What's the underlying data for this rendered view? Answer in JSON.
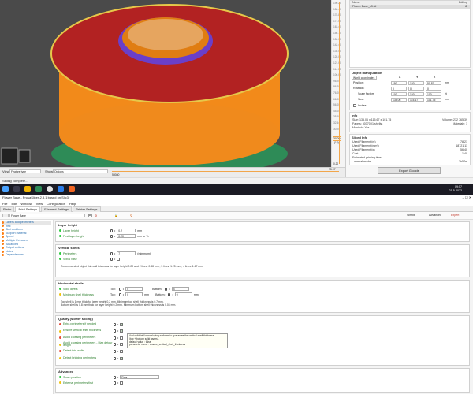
{
  "top": {
    "view_bar": {
      "view_label": "View",
      "view_value": "Feature type",
      "show_label": "Show",
      "show_value": "Options",
      "left_number": "58080",
      "right_number": "95.97"
    },
    "layer_slider": {
      "top_values": [
        "190.20",
        "186.40",
        "178.80",
        "171.00",
        "163.40",
        "156.70",
        "150.00",
        "142.40",
        "135.00",
        "128.00",
        "121.00",
        "114.00",
        "106.00",
        "96.20",
        "86.20",
        "76.00",
        "66.00",
        "56.00",
        "45.00",
        "35.60",
        "32.44",
        "30.20"
      ],
      "highlight": "30.20",
      "sub_highlight": "(14)",
      "bottom": "0.20",
      "bottom_sub": "(1)"
    },
    "objects": {
      "name_col": "Name",
      "editing_col": "Editing",
      "item": "Flower Base_v3.stl"
    },
    "manipulation": {
      "title": "Object manipulation",
      "coord_select": "World coordinates",
      "axes": [
        "X",
        "Y",
        "Z"
      ],
      "position_label": "Position:",
      "position": [
        "190",
        "100",
        "50.87"
      ],
      "position_unit": "mm",
      "rotation_label": "Rotation:",
      "rotation": [
        "0",
        "0",
        "0"
      ],
      "rotation_unit": "°",
      "scale_label": "Scale factors",
      "scale": [
        "100",
        "100",
        "100"
      ],
      "scale_unit": "%",
      "size_label": "Size:",
      "size": [
        "135.06",
        "115.67",
        "101.75"
      ],
      "size_unit": "mm",
      "inches_label": "Inches"
    },
    "info": {
      "title": "Info",
      "size_label": "Size:",
      "size_value": "135.06 x 115.67 x 101.75",
      "volume_label": "Volume:",
      "volume_value": "232 765.39",
      "facets_label": "Facets:",
      "facets_value": "50370 (1 shells)",
      "materials_label": "Materials:",
      "materials_value": "1",
      "manifold_label": "Manifold:",
      "manifold_value": "Yes"
    },
    "sliced": {
      "title": "Sliced Info",
      "rows": [
        {
          "k": "Used Filament (m)",
          "v": "78.21"
        },
        {
          "k": "Used Filament (mm³)",
          "v": "18721.11"
        },
        {
          "k": "Used Filament (g)",
          "v": "56.40"
        },
        {
          "k": "Cost",
          "v": "1.40"
        },
        {
          "k": "Estimated printing time:",
          "v": ""
        },
        {
          "k": "- normal mode",
          "v": "3h57m"
        }
      ]
    },
    "export_button": "Export G-code",
    "status": "Slicing complete..."
  },
  "taskbar": {
    "search_placeholder": "",
    "time": "09:57",
    "date": "21-5-2022"
  },
  "app2": {
    "title": "Flower Base - PrusaSlicer-2.3.1 based on Slic3r",
    "menu": [
      "File",
      "Edit",
      "Window",
      "View",
      "Configuration",
      "Help"
    ],
    "tabs": [
      "Plater",
      "Print Settings",
      "Filament Settings",
      "Printer Settings"
    ],
    "preset": "Flower Base",
    "mode_buttons": [
      "Simple",
      "Advanced",
      "Expert"
    ],
    "tree": [
      {
        "label": "Layers and perimeters",
        "color": "#fd7e14",
        "sel": true
      },
      {
        "label": "Infill",
        "color": "#fd7e14"
      },
      {
        "label": "Skirt and brim",
        "color": "#fd7e14"
      },
      {
        "label": "Support material",
        "color": "#fd7e14"
      },
      {
        "label": "Speed",
        "color": "#fd7e14"
      },
      {
        "label": "Multiple Extruders",
        "color": "#fd7e14"
      },
      {
        "label": "Advanced",
        "color": "#fd7e14"
      },
      {
        "label": "Output options",
        "color": "#fd7e14"
      },
      {
        "label": "Notes",
        "color": "#fd7e14"
      },
      {
        "label": "Dependencies",
        "color": "#fd7e14"
      }
    ],
    "layer_height": {
      "title": "Layer height",
      "rows": [
        {
          "label": "Layer height",
          "value": "0.2",
          "unit": "mm"
        },
        {
          "label": "First layer height",
          "value": "0.20",
          "unit": "mm or %"
        }
      ]
    },
    "vertical_shells": {
      "title": "Vertical shells",
      "perimeters_label": "Perimeters",
      "perimeters_value": "7",
      "perimeters_unit": "(minimum)",
      "spiral_label": "Spiral vase",
      "note": "Recommended object thin wall thickness for layer height 0.20 and 2 lines: 0.88 mm , 3 lines: 1.25 mm , 4 lines: 1.67 mm"
    },
    "horizontal_shells": {
      "title": "Horizontal shells",
      "solid_label": "Solid layers",
      "min_thick_label": "Minimum shell thickness",
      "top_label": "Top:",
      "bottom_label": "Bottom:",
      "solid_top": "5",
      "solid_bottom": "4",
      "min_top": "0",
      "min_bottom": "0",
      "unit": "mm",
      "note": "Top shell is 1 mm thick for layer height 0.2 mm. Minimum top shell thickness is 0.7 mm.\nBottom shell is 0.8 mm thick for layer height 0.2 mm. Minimum bottom shell thickness is 0.04 mm."
    },
    "quality": {
      "title": "Quality (slower slicing)",
      "rows": [
        {
          "label": "Extra perimeters if needed",
          "checked": true
        },
        {
          "label": "Ensure vertical shell thickness",
          "checked": true
        },
        {
          "label": "Avoid crossing perimeters",
          "checked": false
        },
        {
          "label": "Avoid crossing perimeters - Max detour length",
          "checked": false
        },
        {
          "label": "Detect thin walls",
          "checked": false
        },
        {
          "label": "Detect bridging perimeters",
          "checked": true
        }
      ],
      "tooltip_lines": [
        "Add solid infill near sloping surfaces to guarantee the vertical shell thickness",
        "(top + bottom solid layers).",
        "default value     : false",
        "parameter name  : ensure_vertical_shell_thickness"
      ]
    },
    "advanced": {
      "title": "Advanced",
      "seam_label": "Seam position",
      "seam_value": "Rear",
      "ext_label": "External perimeters first"
    }
  }
}
